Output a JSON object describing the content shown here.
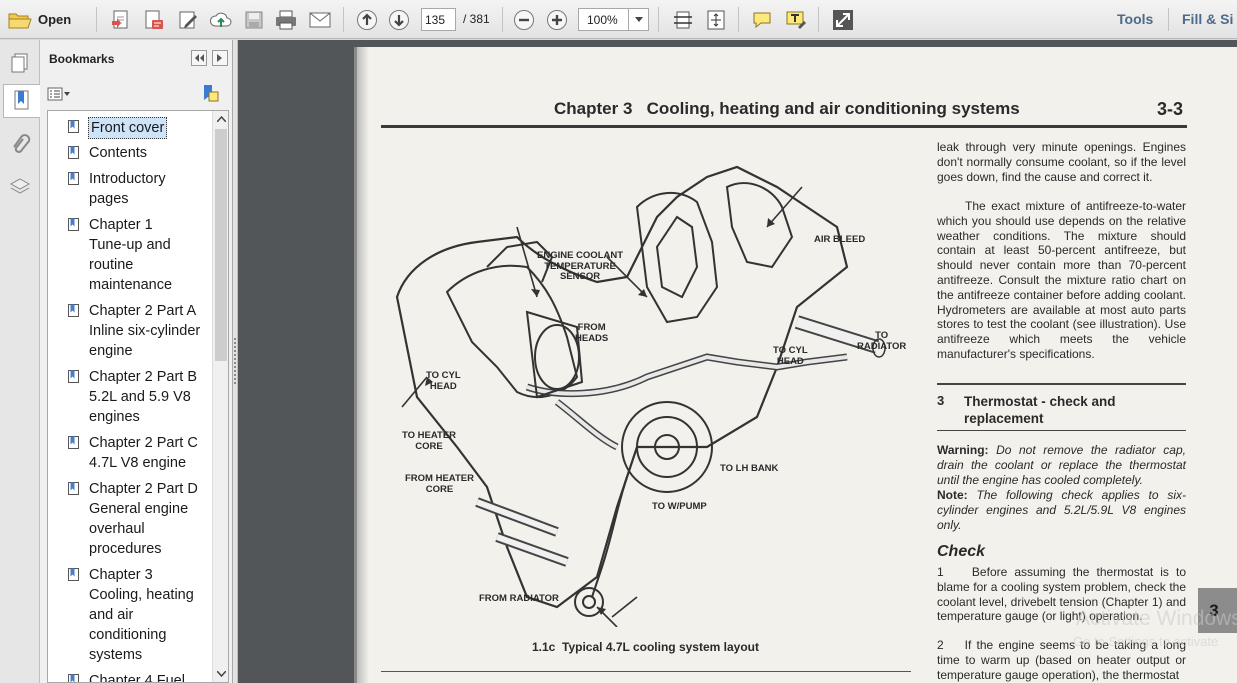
{
  "toolbar": {
    "open_label": "Open",
    "page_current": "135",
    "page_total": "/ 381",
    "zoom": "100%",
    "tools_label": "Tools",
    "fill_sign_label": "Fill & Si"
  },
  "bookmarks": {
    "title": "Bookmarks",
    "items": [
      {
        "label": "Front cover",
        "selected": true
      },
      {
        "label": "Contents"
      },
      {
        "label": "Introductory\npages"
      },
      {
        "label": "Chapter 1\nTune-up and\nroutine\nmaintenance"
      },
      {
        "label": "Chapter 2 Part A\nInline six-cylinder\nengine"
      },
      {
        "label": "Chapter 2 Part B\n5.2L and 5.9 V8\nengines"
      },
      {
        "label": "Chapter 2 Part C\n4.7L V8 engine"
      },
      {
        "label": "Chapter 2 Part D\nGeneral engine\noverhaul\nprocedures"
      },
      {
        "label": "Chapter 3\nCooling, heating\nand air\nconditioning\nsystems"
      },
      {
        "label": "Chapter 4 Fuel"
      }
    ]
  },
  "document": {
    "chapter_heading": "Chapter 3   Cooling, heating and air conditioning systems",
    "page_number": "3-3",
    "para1": "leak through very minute openings. Engines don't normally consume coolant, so if the level goes down, find the cause and correct it.",
    "para2": "The exact mixture of antifreeze-to-water which you should use depends on the relative weather conditions. The mixture should contain at least 50-percent antifreeze, but should never contain more than 70-percent antifreeze. Consult the mixture ratio chart on the antifreeze container before adding coolant. Hydrometers are available at most auto parts stores to test the coolant (see illustration). Use antifreeze which meets the vehicle manufacturer's specifications.",
    "section_number": "3",
    "section_title": "Thermostat - check and replacement",
    "warning_label": "Warning:",
    "warning_text": "Do not remove the radiator cap, drain the coolant or replace the thermostat until the engine has cooled completely.",
    "note_label": "Note:",
    "note_text": "The following check applies to six-cylinder engines and 5.2L/5.9L V8 engines only.",
    "check_heading": "Check",
    "step1": "1    Before assuming the thermostat is to blame for a cooling system problem, check the coolant level, drivebelt tension (Chapter 1) and temperature gauge (or light) operation.",
    "step2": "2    If the engine seems to be taking a long time to warm up (based on heater output or temperature gauge operation), the thermostat",
    "caption": "1.1c  Typical 4.7L cooling system layout",
    "chapter_tab": "3",
    "diagram_labels": {
      "sensor": "ENGINE COOLANT\nTEMPERATURE\nSENSOR",
      "air_bleed": "AIR BLEED",
      "from_heads": "FROM\nHEADS",
      "to_radiator": "TO\nRADIATOR",
      "to_cyl_head_r": "TO CYL\nHEAD",
      "to_cyl_head_l": "TO CYL\nHEAD",
      "to_heater_core": "TO HEATER\nCORE",
      "from_heater_core": "FROM HEATER\nCORE",
      "to_lh_bank": "TO LH BANK",
      "to_wpump": "TO W/PUMP",
      "from_radiator": "FROM RADIATOR"
    }
  },
  "overlay": {
    "watermark": "Activate Windows",
    "watermark_sub": "Go to Settings to activate"
  }
}
